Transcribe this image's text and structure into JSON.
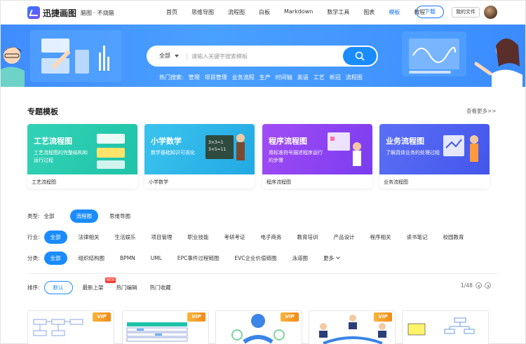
{
  "brand": {
    "name": "迅捷画图",
    "tagline": "脑图 · 不烧脑"
  },
  "nav": {
    "items": [
      "首页",
      "思维导图",
      "流程图",
      "白板",
      "Markdown",
      "数学工具",
      "图表",
      "模板",
      "教程"
    ],
    "active_index": 7,
    "download_label": "下载",
    "my_files_label": "我的文件"
  },
  "search": {
    "scope": "全部",
    "placeholder": "请输入关键字搜索模板",
    "hot_label": "热门搜索:",
    "hot_terms": [
      "管理",
      "项目管理",
      "业务流程",
      "生产",
      "时间轴",
      "英语",
      "工艺",
      "新冠",
      "流程图"
    ]
  },
  "featured": {
    "title": "专题模板",
    "more": "查看更多>>",
    "cards": [
      {
        "title": "工艺流程图",
        "desc": "工艺流程图的完整结构和运行过程",
        "label": "工艺流程图",
        "color1": "#33d2b6",
        "color2": "#1fc3a8"
      },
      {
        "title": "小学数学",
        "desc": "数学基础知识可视化",
        "label": "小学数学",
        "color1": "#3bc3ee",
        "color2": "#22a9e3"
      },
      {
        "title": "程序流程图",
        "desc": "用标准符号描述程序运行的步骤",
        "label": "程序流程图",
        "color1": "#a24cf5",
        "color2": "#7a3cf0"
      },
      {
        "title": "业务流程图",
        "desc": "了解具体业务的处理过程",
        "label": "业务流程图",
        "color1": "#5b6ff5",
        "color2": "#4356ec"
      }
    ]
  },
  "filters": {
    "type": {
      "label": "类型:",
      "options": [
        "全部",
        "流程图",
        "思维导图"
      ],
      "active_index": 1
    },
    "industry": {
      "label": "行业:",
      "options": [
        "全部",
        "法律相关",
        "生活娱乐",
        "项目管理",
        "职业技能",
        "考研考证",
        "电子商务",
        "教育培训",
        "产品设计",
        "程序相关",
        "读书笔记",
        "校园教育"
      ],
      "active_index": 0
    },
    "category": {
      "label": "分类:",
      "options": [
        "全部",
        "组织结构图",
        "BPMN",
        "UML",
        "EPC事件过程链图",
        "EVC企业价值链图",
        "泳道图"
      ],
      "more": "更多",
      "active_index": 0
    }
  },
  "sort": {
    "label": "排序:",
    "options": [
      "默认",
      "最新上架",
      "热门编辑",
      "热门收藏"
    ],
    "new_badge": "NEW",
    "page": "1/48"
  },
  "thumbs": {
    "vip_label": "VIP"
  }
}
